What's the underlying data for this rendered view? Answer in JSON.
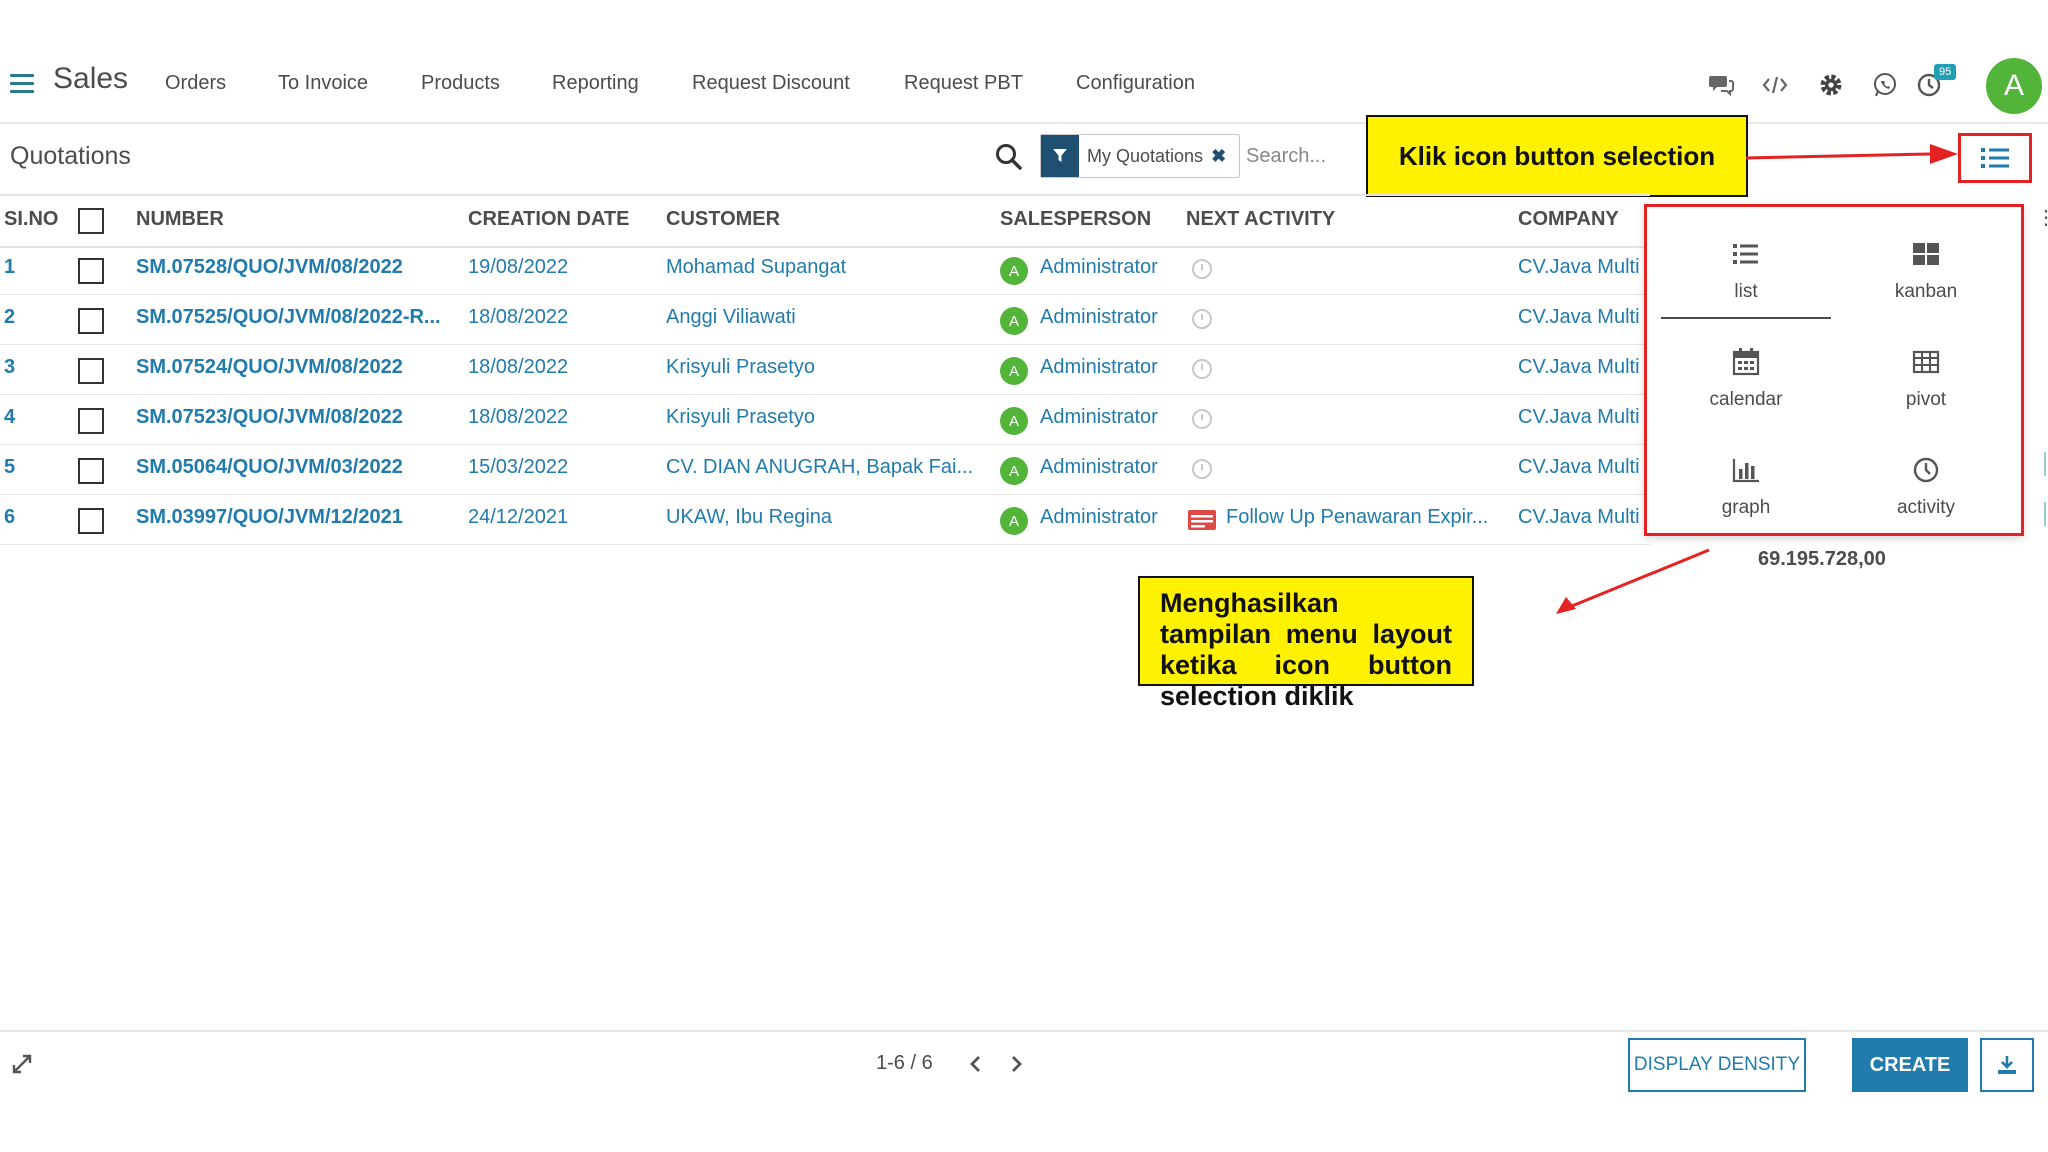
{
  "nav": {
    "app_title": "Sales",
    "menu": [
      "Orders",
      "To Invoice",
      "Products",
      "Reporting",
      "Request Discount",
      "Request PBT",
      "Configuration"
    ],
    "activity_badge": "95",
    "user_initial": "A"
  },
  "control": {
    "title": "Quotations",
    "facet_label": "My Quotations",
    "search_placeholder": "Search...",
    "callout_top": "Klik icon button selection"
  },
  "table": {
    "headers": {
      "no": "SI.NO",
      "number": "NUMBER",
      "date": "CREATION DATE",
      "customer": "CUSTOMER",
      "salesperson": "SALESPERSON",
      "activity": "NEXT ACTIVITY",
      "company": "COMPANY"
    },
    "rows": [
      {
        "no": "1",
        "number": "SM.07528/QUO/JVM/08/2022",
        "date": "19/08/2022",
        "customer": "Mohamad Supangat",
        "avatar": "A",
        "salesperson": "Administrator",
        "activity": "",
        "company": "CV.Java Multi"
      },
      {
        "no": "2",
        "number": "SM.07525/QUO/JVM/08/2022-R...",
        "date": "18/08/2022",
        "customer": "Anggi Viliawati",
        "avatar": "A",
        "salesperson": "Administrator",
        "activity": "",
        "company": "CV.Java Multi"
      },
      {
        "no": "3",
        "number": "SM.07524/QUO/JVM/08/2022",
        "date": "18/08/2022",
        "customer": "Krisyuli Prasetyo",
        "avatar": "A",
        "salesperson": "Administrator",
        "activity": "",
        "company": "CV.Java Multi"
      },
      {
        "no": "4",
        "number": "SM.07523/QUO/JVM/08/2022",
        "date": "18/08/2022",
        "customer": "Krisyuli Prasetyo",
        "avatar": "A",
        "salesperson": "Administrator",
        "activity": "",
        "company": "CV.Java Multi"
      },
      {
        "no": "5",
        "number": "SM.05064/QUO/JVM/03/2022",
        "date": "15/03/2022",
        "customer": "CV. DIAN ANUGRAH, Bapak Fai...",
        "avatar": "A",
        "salesperson": "Administrator",
        "activity": "",
        "company": "CV.Java Multi"
      },
      {
        "no": "6",
        "number": "SM.03997/QUO/JVM/12/2021",
        "date": "24/12/2021",
        "customer": "UKAW, Ibu Regina",
        "avatar": "A",
        "salesperson": "Administrator",
        "activity": "Follow Up Penawaran Expir...",
        "company": "CV.Java Multi"
      }
    ],
    "total": "69.195.728,00"
  },
  "views": {
    "list": "list",
    "kanban": "kanban",
    "calendar": "calendar",
    "pivot": "pivot",
    "graph": "graph",
    "activity": "activity",
    "active": "list"
  },
  "callout_bottom": "Menghasilkan tampilan menu layout ketika icon button selection diklik",
  "footer": {
    "pager": "1-6 / 6",
    "density_label": "DISPLAY DENSITY",
    "create_label": "CREATE"
  },
  "colors": {
    "accent": "#217bac",
    "nav_dark": "#1f4f71",
    "avatar_green": "#53b43a",
    "callout_yellow": "#fff200",
    "highlight_red": "#e52222"
  }
}
